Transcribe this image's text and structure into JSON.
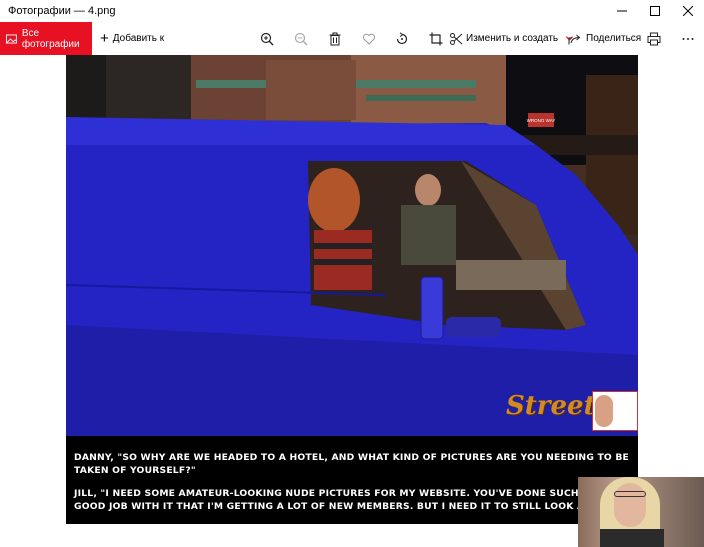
{
  "window": {
    "title": "Фотографии — 4.png",
    "controls": [
      "minimize-icon",
      "maximize-icon",
      "close-icon"
    ]
  },
  "toolbar": {
    "all_photos_label": "Все фотографии",
    "add_to_label": "Добавить к",
    "edit_create_label": "Изменить и создать",
    "share_label": "Поделиться",
    "icons": [
      "zoom-in-icon",
      "zoom-out-icon",
      "delete-icon",
      "favorite-icon",
      "rotate-icon",
      "crop-icon",
      "edit-create-icon",
      "share-icon",
      "print-icon",
      "more-icon"
    ],
    "accent_color": "#e81123"
  },
  "photo": {
    "caption_line1": "Danny, \"So why are we headed to a hotel, and what kind of pictures are you needing to be\ntaken of yourself?\"",
    "caption_line2": "Jill, \"I need some amateur-looking nude pictures for my website. You've done such a\ngood job with it that I'm getting a lot of new members. But I need it to still look amateur",
    "logo_text": "Street",
    "sign_text": "WRONG WAY"
  }
}
